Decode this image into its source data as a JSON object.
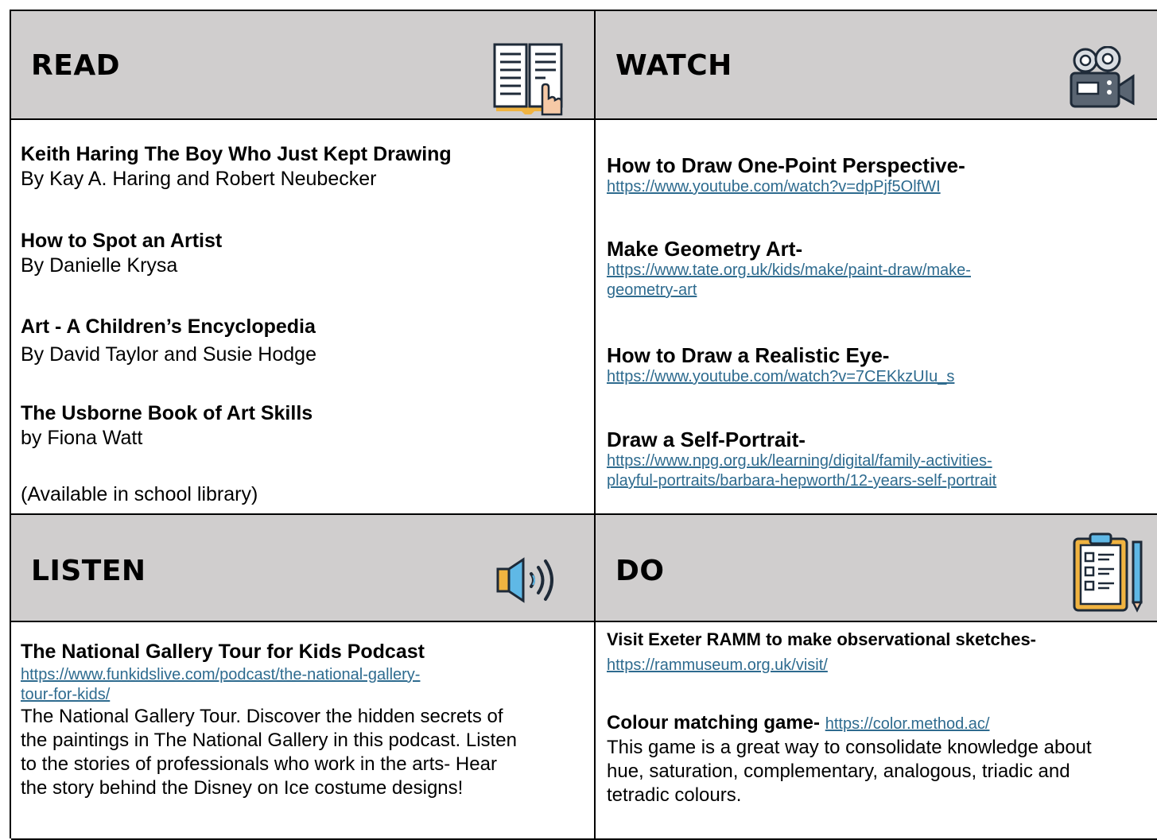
{
  "read": {
    "title": "READ",
    "items": [
      {
        "title": "Keith Haring The Boy Who Just Kept Drawing",
        "byline": "By Kay A. Haring and Robert Neubecker"
      },
      {
        "title": "How to Spot an Artist",
        "byline": "By Danielle Krysa"
      },
      {
        "title": "Art - A Children’s Encyclopedia",
        "byline": "By David Taylor and Susie Hodge"
      },
      {
        "title": "The Usborne Book of Art Skills",
        "byline": "by Fiona Watt"
      }
    ],
    "note": "(Available in school library)",
    "icon": "open-book-icon"
  },
  "watch": {
    "title": "WATCH",
    "items": [
      {
        "title": "How to Draw One-Point Perspective-",
        "url_lines": [
          "https://www.youtube.com/watch?v=dpPjf5OlfWI"
        ]
      },
      {
        "title": "Make Geometry Art-",
        "url_lines": [
          "https://www.tate.org.uk/kids/make/paint-draw/make-",
          "geometry-art"
        ]
      },
      {
        "title": "How to Draw a Realistic Eye-",
        "url_lines": [
          "https://www.youtube.com/watch?v=7CEKkzUIu_s"
        ]
      },
      {
        "title": "Draw a Self-Portrait-",
        "url_lines": [
          "https://www.npg.org.uk/learning/digital/family-activities-",
          "playful-portraits/barbara-hepworth/12-years-self-portrait"
        ]
      }
    ],
    "icon": "film-camera-icon"
  },
  "listen": {
    "title": "LISTEN",
    "item_title": "The National Gallery Tour for Kids Podcast",
    "url_lines": [
      "https://www.funkidslive.com/podcast/the-national-gallery-",
      "tour-for-kids/"
    ],
    "description_lines": [
      "The National Gallery Tour. Discover the hidden secrets of",
      "the paintings in The National Gallery in this podcast. Listen",
      "to the stories of professionals who work in the arts- Hear",
      "the story behind the Disney on Ice costume designs!"
    ],
    "icon": "speaker-icon"
  },
  "do": {
    "title": "DO",
    "item1_title": "Visit Exeter RAMM to make observational sketches-",
    "item1_url": "https://rammuseum.org.uk/visit/",
    "item2_title": "Colour matching game-",
    "item2_url": "https://color.method.ac/",
    "description_lines": [
      "This game is a great way to consolidate knowledge about",
      "hue, saturation, complementary, analogous, triadic and",
      "tetradic colours."
    ],
    "icon": "clipboard-checklist-icon"
  },
  "colors": {
    "header_bg": "#d0cece",
    "link": "#2e6b8f",
    "border": "#000000"
  }
}
